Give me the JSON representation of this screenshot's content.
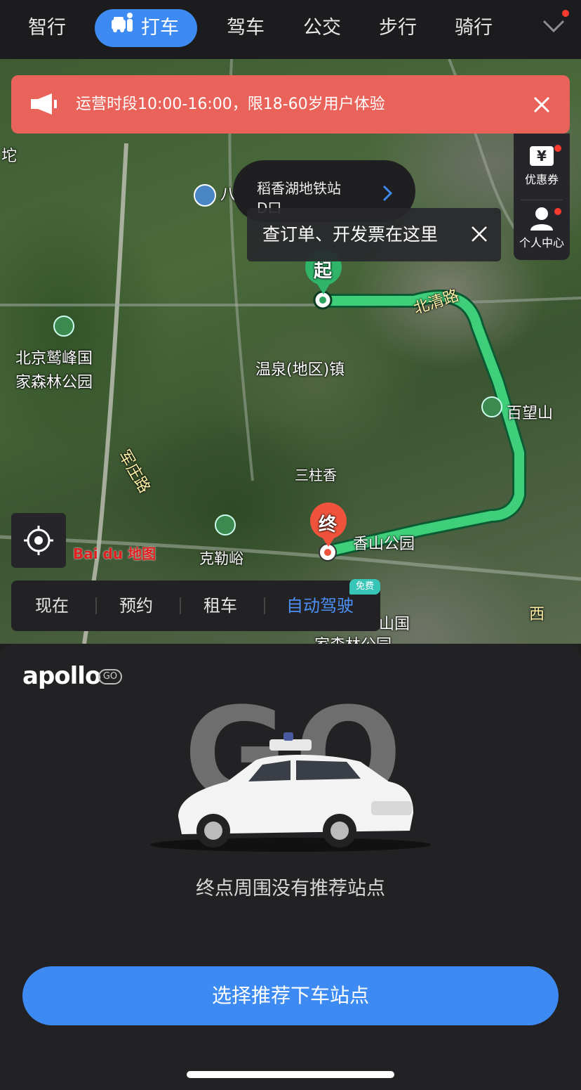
{
  "tabs": [
    {
      "label": "智行",
      "active": false
    },
    {
      "label": "打车",
      "active": true
    },
    {
      "label": "驾车",
      "active": false
    },
    {
      "label": "公交",
      "active": false
    },
    {
      "label": "步行",
      "active": false
    },
    {
      "label": "骑行",
      "active": false
    }
  ],
  "banner": {
    "text": "运营时段10:00-16:00，限18-60岁用户体验",
    "color": "#e9635a"
  },
  "side": {
    "coupon": "优惠券",
    "coupon_glyph": "¥",
    "profile": "个人中心"
  },
  "start_bubble": {
    "line1": "稻香湖地铁站",
    "line2": "D口"
  },
  "tooltip": {
    "text": "查订单、开发票在这里"
  },
  "map": {
    "start_marker": "起",
    "end_marker": "终",
    "labels": {
      "forest_park": [
        "北京鹫峰国",
        "家森林公园"
      ],
      "town": "温泉(地区)镇",
      "road_beiqing": "北清路",
      "baiwangshan": "百望山",
      "sanzhuxiang": "三柱香",
      "xiangshan": "香山公园",
      "kelexin": "克勒峪",
      "junzhuang": "军庄路",
      "partial_left": "坨",
      "partial_top": "八",
      "partial_bottom": [
        "山国",
        "家森林公园"
      ],
      "west": "西"
    },
    "watermark": "Bai du 地图"
  },
  "subtabs": [
    {
      "label": "现在",
      "active": false
    },
    {
      "label": "预约",
      "active": false
    },
    {
      "label": "租车",
      "active": false
    },
    {
      "label": "自动驾驶",
      "active": true
    }
  ],
  "free_badge": "免费",
  "panel": {
    "brand": "apollo",
    "brand_badge": "GO",
    "hero_text": "GO",
    "message": "终点周围没有推荐站点",
    "cta": "选择推荐下车站点"
  },
  "colors": {
    "accent": "#3d8bf2",
    "route": "#3fcf7a",
    "banner": "#e9635a",
    "marker_end": "#f0533c"
  }
}
